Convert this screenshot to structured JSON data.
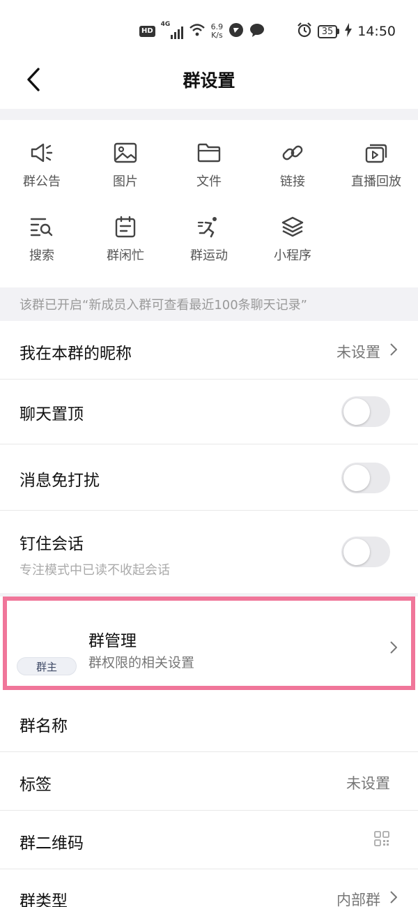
{
  "status_bar": {
    "hd": "HD",
    "network": "4G",
    "speed_top": "6.9",
    "speed_bottom": "K/s",
    "battery": "35",
    "time": "14:50"
  },
  "header": {
    "title": "群设置"
  },
  "tools": [
    {
      "label": "群公告",
      "icon": "megaphone-icon"
    },
    {
      "label": "图片",
      "icon": "image-icon"
    },
    {
      "label": "文件",
      "icon": "folder-icon"
    },
    {
      "label": "链接",
      "icon": "link-icon"
    },
    {
      "label": "直播回放",
      "icon": "playback-icon"
    },
    {
      "label": "搜索",
      "icon": "search-list-icon"
    },
    {
      "label": "群闲忙",
      "icon": "calendar-icon"
    },
    {
      "label": "群运动",
      "icon": "running-icon"
    },
    {
      "label": "小程序",
      "icon": "layers-icon"
    }
  ],
  "notice": "该群已开启“新成员入群可查看最近100条聊天记录”",
  "rows": {
    "nickname": {
      "label": "我在本群的昵称",
      "value": "未设置"
    },
    "pin_chat": {
      "label": "聊天置顶",
      "on": false
    },
    "mute": {
      "label": "消息免打扰",
      "on": false
    },
    "stick_session": {
      "label": "钉住会话",
      "sub": "专注模式中已读不收起会话",
      "on": false
    },
    "management": {
      "badge": "群主",
      "label": "群管理",
      "sub": "群权限的相关设置"
    },
    "group_name": {
      "label": "群名称"
    },
    "tags": {
      "label": "标签",
      "value": "未设置"
    },
    "qr_code": {
      "label": "群二维码"
    },
    "group_type": {
      "label": "群类型",
      "value": "内部群"
    }
  },
  "colors": {
    "highlight_border": "#f0769a",
    "toggle_off": "#e9e9ec"
  }
}
